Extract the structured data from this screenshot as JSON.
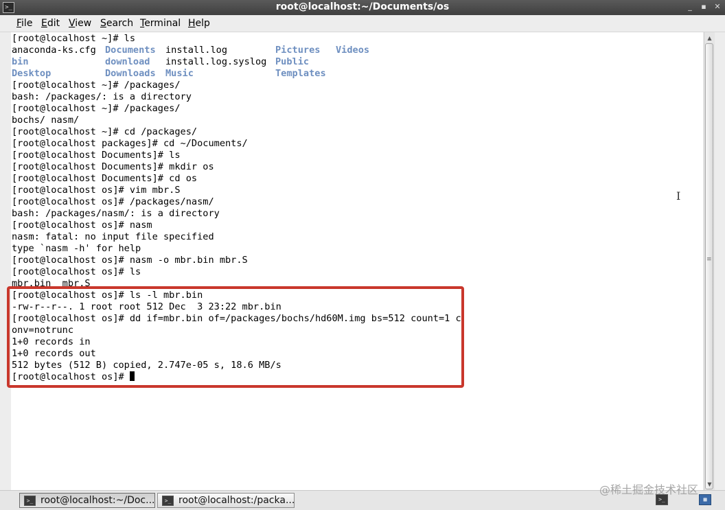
{
  "window": {
    "title": "root@localhost:~/Documents/os"
  },
  "menu": [
    {
      "mnemonic": "F",
      "rest": "ile"
    },
    {
      "mnemonic": "E",
      "rest": "dit"
    },
    {
      "mnemonic": "V",
      "rest": "iew"
    },
    {
      "mnemonic": "S",
      "rest": "earch"
    },
    {
      "mnemonic": "T",
      "rest": "erminal"
    },
    {
      "mnemonic": "H",
      "rest": "elp"
    }
  ],
  "terminal": {
    "ls_listing": {
      "col1": [
        "anaconda-ks.cfg",
        "bin",
        "Desktop"
      ],
      "col2": [
        "Documents",
        "download",
        "Downloads"
      ],
      "col3": [
        "install.log",
        "install.log.syslog",
        "Music"
      ],
      "col4": [
        "Pictures",
        "Public",
        "Templates"
      ],
      "col5": [
        "Videos"
      ]
    },
    "lines": [
      "[root@localhost ~]# ls",
      "[root@localhost ~]# /packages/",
      "bash: /packages/: is a directory",
      "[root@localhost ~]# /packages/",
      "bochs/ nasm/",
      "[root@localhost ~]# cd /packages/",
      "[root@localhost packages]# cd ~/Documents/",
      "[root@localhost Documents]# ls",
      "[root@localhost Documents]# mkdir os",
      "[root@localhost Documents]# cd os",
      "[root@localhost os]# vim mbr.S",
      "[root@localhost os]# /packages/nasm/",
      "bash: /packages/nasm/: is a directory",
      "[root@localhost os]# nasm",
      "nasm: fatal: no input file specified",
      "type `nasm -h' for help",
      "[root@localhost os]# nasm -o mbr.bin mbr.S",
      "[root@localhost os]# ls",
      "mbr.bin  mbr.S",
      "[root@localhost os]# ls -l mbr.bin",
      "-rw-r--r--. 1 root root 512 Dec  3 23:22 mbr.bin",
      "[root@localhost os]# dd if=mbr.bin of=/packages/bochs/hd60M.img bs=512 count=1 c",
      "onv=notrunc",
      "1+0 records in",
      "1+0 records out",
      "512 bytes (512 B) copied, 2.747e-05 s, 18.6 MB/s",
      "[root@localhost os]# "
    ]
  },
  "taskbar": {
    "tasks": [
      "root@localhost:~/Doc...",
      "root@localhost:/packa..."
    ]
  },
  "watermark": "@稀土掘金技术社区",
  "colors": {
    "directory": "#6e8fc0",
    "highlight_border": "#c9372c"
  }
}
